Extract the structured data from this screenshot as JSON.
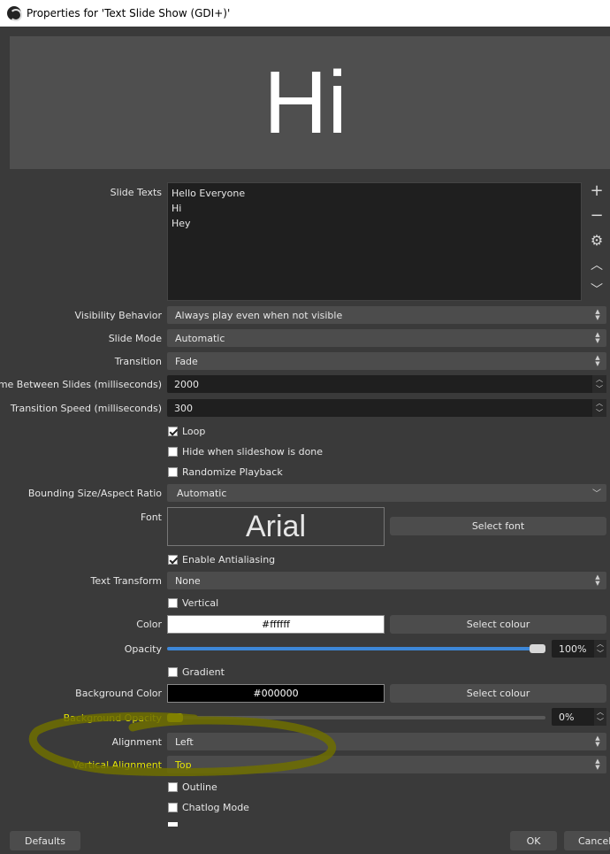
{
  "window": {
    "title": "Properties for 'Text Slide Show (GDI+)'"
  },
  "preview": {
    "text": "Hi"
  },
  "slide_texts": {
    "label": "Slide Texts",
    "lines": [
      "Hello Everyone",
      "Hi",
      "Hey"
    ],
    "buttons": {
      "add": "+",
      "remove": "−",
      "settings": "⚙",
      "up": "︿",
      "down": "﹀"
    }
  },
  "fields": {
    "visibility": {
      "label": "Visibility Behavior",
      "value": "Always play even when not visible"
    },
    "slide_mode": {
      "label": "Slide Mode",
      "value": "Automatic"
    },
    "transition": {
      "label": "Transition",
      "value": "Fade"
    },
    "time_between": {
      "label": "Time Between Slides (milliseconds)",
      "value": "2000"
    },
    "transition_speed": {
      "label": "Transition Speed (milliseconds)",
      "value": "300"
    },
    "bounding": {
      "label": "Bounding Size/Aspect Ratio",
      "value": "Automatic"
    },
    "font": {
      "label": "Font",
      "preview": "Arial",
      "button": "Select font"
    },
    "text_transform": {
      "label": "Text Transform",
      "value": "None"
    },
    "color": {
      "label": "Color",
      "value": "#ffffff",
      "button": "Select colour",
      "swatch": "#ffffff"
    },
    "opacity": {
      "label": "Opacity",
      "value": "100%",
      "level": 1.0
    },
    "bg_color": {
      "label": "Background Color",
      "value": "#000000",
      "button": "Select colour",
      "swatch": "#000000"
    },
    "bg_opacity": {
      "label": "Background Opacity",
      "value": "0%",
      "level": 0.0
    },
    "alignment": {
      "label": "Alignment",
      "value": "Left"
    },
    "vertical_alignment": {
      "label": "Vertical Alignment",
      "value": "Top"
    }
  },
  "checks": {
    "loop": {
      "label": "Loop",
      "checked": true
    },
    "hide_done": {
      "label": "Hide when slideshow is done",
      "checked": false
    },
    "randomize": {
      "label": "Randomize Playback",
      "checked": false
    },
    "antialias": {
      "label": "Enable Antialiasing",
      "checked": true
    },
    "vertical": {
      "label": "Vertical",
      "checked": false
    },
    "gradient": {
      "label": "Gradient",
      "checked": false
    },
    "outline": {
      "label": "Outline",
      "checked": false
    },
    "chatlog": {
      "label": "Chatlog Mode",
      "checked": false
    }
  },
  "footer": {
    "defaults": "Defaults",
    "ok": "OK",
    "cancel": "Cancel"
  },
  "colors": {
    "accent": "#3d87d8",
    "highlight": "#e6e600",
    "annotation": "#6e6e00"
  }
}
